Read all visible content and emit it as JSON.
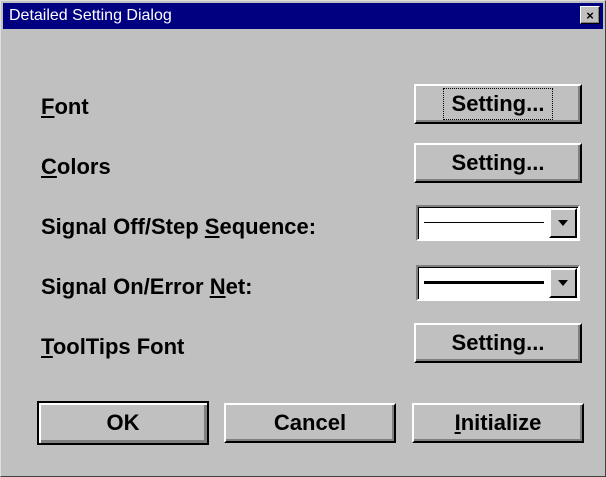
{
  "window": {
    "title": "Detailed Setting Dialog",
    "close_glyph": "×"
  },
  "rows": [
    {
      "label_mnemonic": "F",
      "label_rest": "ont",
      "button_label": "Setting..."
    },
    {
      "label_mnemonic": "C",
      "label_rest": "olors",
      "button_label": "Setting..."
    },
    {
      "label_pre": "Signal Off/Step ",
      "label_mnemonic": "S",
      "label_rest": "equence:"
    },
    {
      "label_pre": "Signal On/Error ",
      "label_mnemonic": "N",
      "label_rest": "et:"
    },
    {
      "label_mnemonic": "T",
      "label_rest": "oolTips Font",
      "button_label": "Setting..."
    }
  ],
  "footer": {
    "ok_label": "OK",
    "cancel_label": "Cancel",
    "initialize_mnemonic": "I",
    "initialize_rest": "nitialize"
  },
  "icons": {
    "close": "close-icon",
    "dropdown": "chevron-down-icon"
  }
}
